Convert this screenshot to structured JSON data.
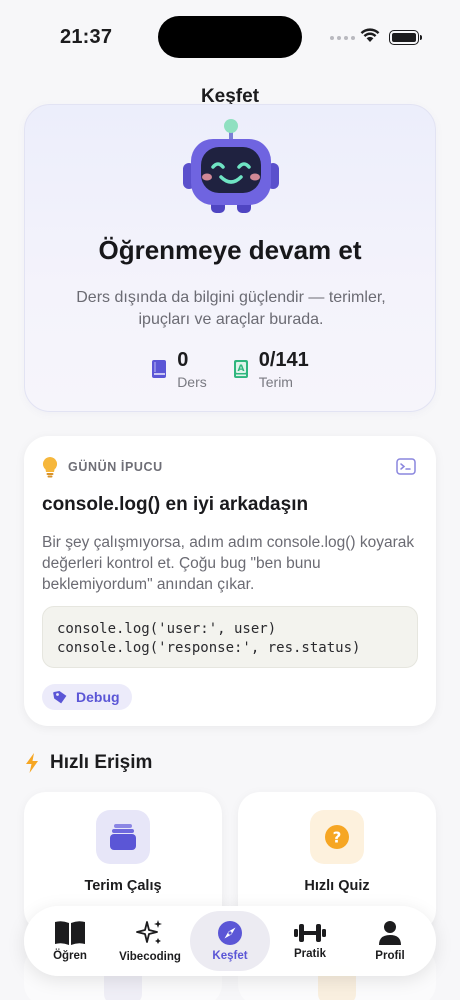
{
  "status_bar": {
    "time": "21:37"
  },
  "nav": {
    "title": "Keşfet"
  },
  "hero": {
    "title": "Öğrenmeye devam et",
    "subtitle": "Ders dışında da bilgini güçlendir — terimler, ipuçları ve araçlar burada.",
    "stats": [
      {
        "value": "0",
        "label": "Ders",
        "icon": "book-icon"
      },
      {
        "value": "0/141",
        "label": "Terim",
        "icon": "dictionary-icon"
      }
    ]
  },
  "tip": {
    "eyebrow": "GÜNÜN İPUCU",
    "title": "console.log() en iyi arkadaşın",
    "body": "Bir şey çalışmıyorsa, adım adım console.log() koyarak değerleri kontrol et. Çoğu bug \"ben bunu beklemiyordum\" anından çıkar.",
    "code": "console.log('user:', user)\nconsole.log('response:', res.status)",
    "tag": "Debug"
  },
  "quick_access": {
    "title": "Hızlı Erişim",
    "cards": [
      {
        "label": "Terim Çalış",
        "icon": "cards-icon"
      },
      {
        "label": "Hızlı Quiz",
        "icon": "question-icon"
      }
    ]
  },
  "tabs": [
    {
      "label": "Öğren",
      "icon": "book-open-icon"
    },
    {
      "label": "Vibecoding",
      "icon": "sparkles-icon"
    },
    {
      "label": "Keşfet",
      "icon": "compass-icon"
    },
    {
      "label": "Pratik",
      "icon": "dumbbell-icon"
    },
    {
      "label": "Profil",
      "icon": "person-icon"
    }
  ],
  "active_tab": "Keşfet",
  "colors": {
    "accent": "#5b56d6",
    "robot": "#6f64e0",
    "tip_bulb": "#f6b73c",
    "quiz": "#f6a623",
    "lightning": "#f6a623"
  }
}
